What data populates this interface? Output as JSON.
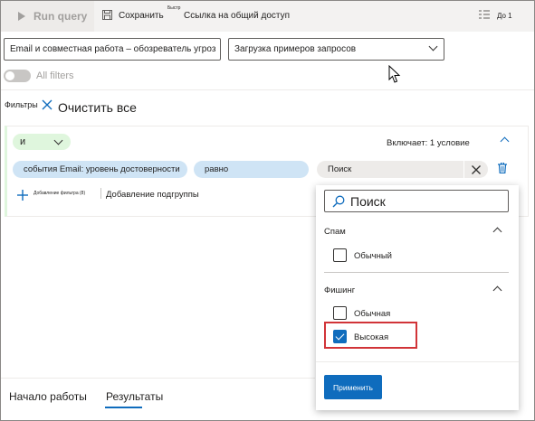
{
  "toolbar": {
    "run_query": "Run query",
    "save": "Сохранить",
    "save_badge": "Быстр",
    "share_link": "Ссылка на общий доступ",
    "collapse": "До 1"
  },
  "selectors": {
    "schema": "Email и совместная работа – обозреватель угроз",
    "sample_queries": "Загрузка примеров запросов"
  },
  "all_filters_label": "All filters",
  "filters": {
    "title": "Фильтры",
    "clear_all": "Очистить все",
    "operator": "и",
    "includes": "Включает: 1 условие",
    "condition": {
      "field": "события Email: уровень достоверности",
      "op": "равно",
      "value_placeholder": "Поиск"
    },
    "add_filter": "Добавление фильтра (8)",
    "add_subgroup": "Добавление подгруппы"
  },
  "dropdown": {
    "search_placeholder": "Поиск",
    "groups": [
      {
        "title": "Спам",
        "options": [
          {
            "label": "Обычный",
            "checked": false
          }
        ]
      },
      {
        "title": "Фишинг",
        "options": [
          {
            "label": "Обычная",
            "checked": false
          },
          {
            "label": "Высокая",
            "checked": true
          }
        ]
      }
    ],
    "apply": "Применить"
  },
  "tabs": [
    "Начало работы",
    "Результаты"
  ],
  "colors": {
    "accent": "#0f6cbd",
    "highlight_border": "#d13438",
    "pill": "#cfe4f5",
    "green": "#dff6dd"
  }
}
